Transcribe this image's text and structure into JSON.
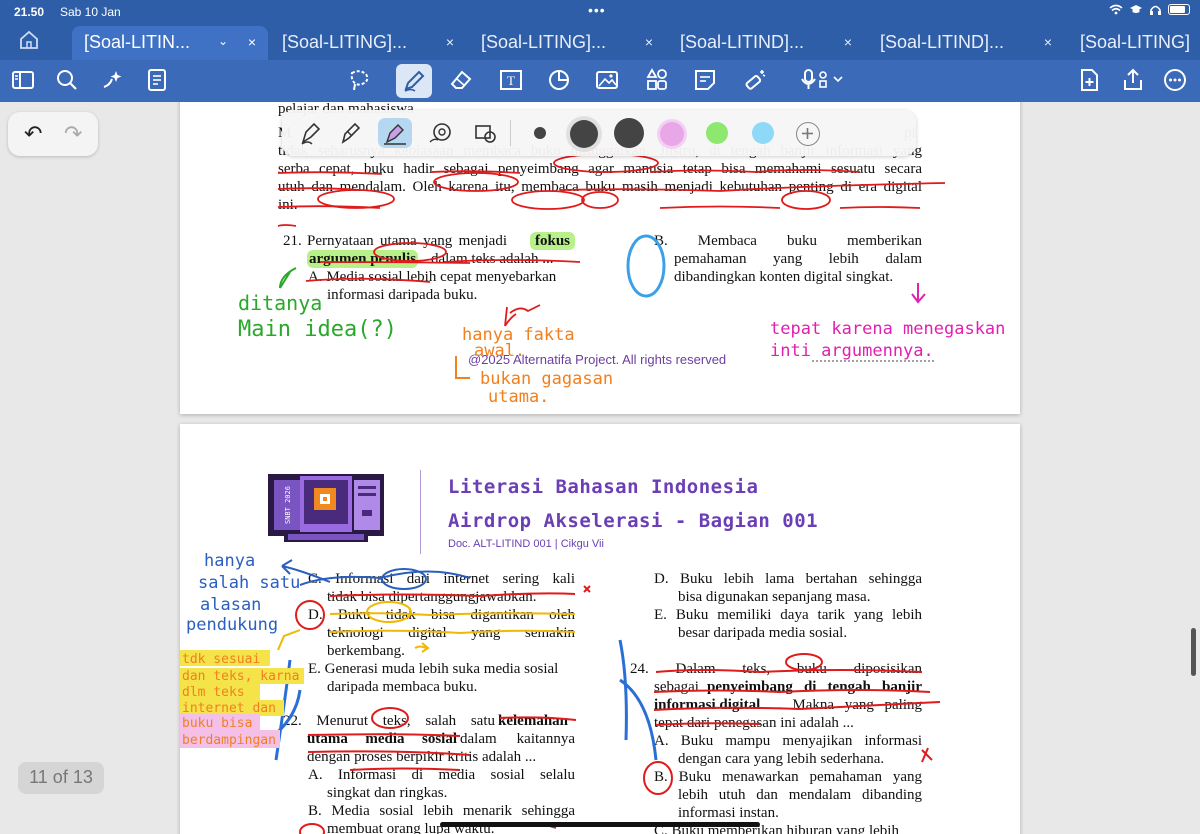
{
  "status": {
    "time": "21.50",
    "date": "Sab 10 Jan",
    "dots": "•••"
  },
  "tabs": [
    {
      "label": "[Soal-LITIN...",
      "active": true
    },
    {
      "label": "[Soal-LITING]..."
    },
    {
      "label": "[Soal-LITING]..."
    },
    {
      "label": "[Soal-LITIND]..."
    },
    {
      "label": "[Soal-LITIND]..."
    },
    {
      "label": "[Soal-LITING]"
    }
  ],
  "tab_close": "×",
  "tab_chevron": "⌄",
  "toolbar_icons": [
    "sidebar-icon",
    "search-icon",
    "ai-sparkle-icon",
    "document-list-icon",
    "lasso-icon",
    "pen-icon",
    "eraser-icon",
    "text-box-icon",
    "shapes-icon",
    "image-icon",
    "elements-icon",
    "sticky-note-icon",
    "laser-pointer-icon",
    "microphone-icon",
    "add-page-icon",
    "share-icon",
    "more-icon"
  ],
  "undo": {
    "undo": "↶",
    "redo": "↷"
  },
  "pagecount": "11 of 13",
  "page1": {
    "line0": "pelajar dan mahasiswa",
    "line_m": "M",
    "line_pi": "pi",
    "line1": "tidak seharusnya kebiasaan membaca buku ditinggalkan. Justru, di tengah banjir informasi yang",
    "line2": "serba cepat, buku hadir sebagai penyeimbang agar manusia tetap bisa memahami sesuatu secara",
    "line3": "utuh dan mendalam. Oleh karena itu, membaca buku masih menjadi kebutuhan penting di era digital",
    "line4": "ini.",
    "q21_num": "21.",
    "q21_a": "Pernyataan utama yang menjadi",
    "q21_fokus": "fokus",
    "q21_b": "argumen penulis",
    "q21_c": "dalam teks adalah ...",
    "q21_A1": "A.  Media sosial lebih cepat menyebarkan",
    "q21_A2": "informasi daripada buku.",
    "q21_B1": "B.  Membaca buku memberikan",
    "q21_B2": "pemahaman yang lebih dalam",
    "q21_B3": "dibandingkan konten digital singkat.",
    "copyright": "@2025 Alternatifa Project. All rights reserved"
  },
  "page2": {
    "header1": "Literasi Bahasan Indonesia",
    "header2": "Airdrop Akselerasi - Bagian 001",
    "header3": "Doc. ALT-LITIND 001 | Cikgu Vii",
    "logo_text": "SNBT 2026",
    "C1": "C.  Informasi dari internet sering kali",
    "C2": "tidak bisa dipertanggungjawabkan.",
    "D1": "D.  Buku tidak bisa digantikan oleh",
    "D2": "teknologi digital yang semakin",
    "D3": "berkembang.",
    "E1": "E.  Generasi muda lebih suka media sosial",
    "E2": "daripada membaca buku.",
    "q22_1a": "22. Menurut teks, salah satu",
    "q22_1b": "kelemahan",
    "q22_2a": "utama media sosial",
    "q22_2b": "dalam kaitannya",
    "q22_3": "dengan proses berpikir kritis adalah ...",
    "q22_A1": "A.  Informasi di media sosial selalu",
    "q22_A2": "singkat dan ringkas.",
    "q22_B1": "B.  Media sosial lebih menarik sehingga",
    "q22_B2": "membuat orang lupa waktu.",
    "rD1": "D.  Buku lebih lama bertahan sehingga",
    "rD2": "bisa digunakan sepanjang masa.",
    "rE1": "E.  Buku memiliki daya tarik yang lebih",
    "rE2": "besar daripada media sosial.",
    "q24_1": "24. Dalam teks, buku diposisikan",
    "q24_2a": "sebagai",
    "q24_2b": "penyeimbang di tengah banjir",
    "q24_3a": "informasi digital",
    "q24_3b": ". Makna yang paling",
    "q24_4": "tepat dari penegasan ini adalah ...",
    "q24_A1": "A.  Buku mampu menyajikan informasi",
    "q24_A2": "dengan cara yang lebih sederhana.",
    "q24_B1": "B.  Buku menawarkan pemahaman yang",
    "q24_B2": "lebih utuh dan mendalam dibanding",
    "q24_B3": "informasi instan.",
    "q24_C1": "C.  Buku memberikan hiburan yang lebih"
  },
  "handwriting": {
    "ditanya": "ditanya",
    "main_idea": "Main idea(?)",
    "hanya_fakta": "hanya fakta",
    "awal": "awal.",
    "bukan_gagasan": "bukan gagasan",
    "utama": "utama.",
    "tepat_karena": "tepat karena menegaskan",
    "inti_argumen": "inti argumennya.",
    "hanya_salah": "hanya",
    "satu_1": "salah satu",
    "satu_2": "alasan",
    "pendukung": "pendukung",
    "tdk_sesuai": "tdk sesuai",
    "dan_teks": "dan teks, karna",
    "dlm_teks": "dlm teks",
    "internet_dan": "internet dan",
    "buku_bisa": "buku bisa",
    "berdampingan": "berdampingan"
  },
  "colors": {
    "accent": "#2f5ea8",
    "ink_red": "#e01b1b",
    "ink_blue": "#2a6fd6",
    "ink_green": "#2aa82a",
    "ink_orange": "#f08020",
    "ink_pink": "#e020b0",
    "ink_lightblue": "#3aa0e8",
    "ink_yellow": "#f0b800",
    "purple": "#6a3fb5"
  }
}
